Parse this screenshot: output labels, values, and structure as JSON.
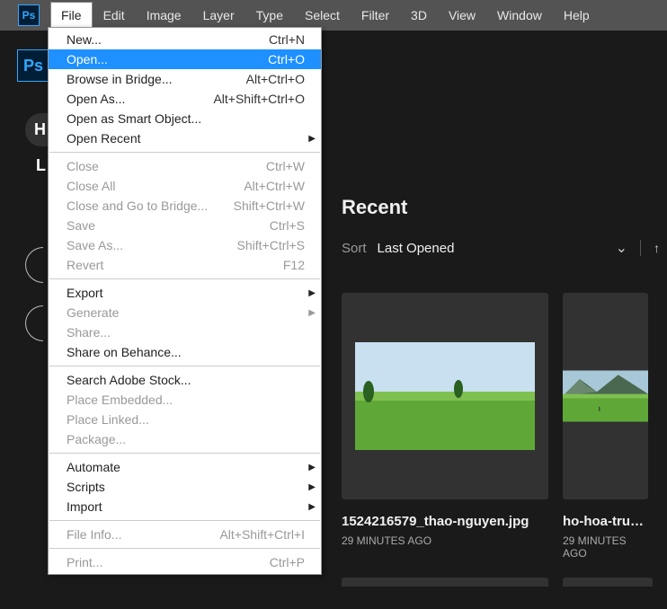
{
  "app_icon_text": "Ps",
  "menubar": [
    "File",
    "Edit",
    "Image",
    "Layer",
    "Type",
    "Select",
    "Filter",
    "3D",
    "View",
    "Window",
    "Help"
  ],
  "file_menu": [
    {
      "label": "New...",
      "shortcut": "Ctrl+N",
      "type": "item"
    },
    {
      "label": "Open...",
      "shortcut": "Ctrl+O",
      "type": "item",
      "highlight": true
    },
    {
      "label": "Browse in Bridge...",
      "shortcut": "Alt+Ctrl+O",
      "type": "item"
    },
    {
      "label": "Open As...",
      "shortcut": "Alt+Shift+Ctrl+O",
      "type": "item"
    },
    {
      "label": "Open as Smart Object...",
      "shortcut": "",
      "type": "item"
    },
    {
      "label": "Open Recent",
      "shortcut": "",
      "type": "submenu"
    },
    {
      "type": "sep"
    },
    {
      "label": "Close",
      "shortcut": "Ctrl+W",
      "type": "item",
      "disabled": true
    },
    {
      "label": "Close All",
      "shortcut": "Alt+Ctrl+W",
      "type": "item",
      "disabled": true
    },
    {
      "label": "Close and Go to Bridge...",
      "shortcut": "Shift+Ctrl+W",
      "type": "item",
      "disabled": true
    },
    {
      "label": "Save",
      "shortcut": "Ctrl+S",
      "type": "item",
      "disabled": true
    },
    {
      "label": "Save As...",
      "shortcut": "Shift+Ctrl+S",
      "type": "item",
      "disabled": true
    },
    {
      "label": "Revert",
      "shortcut": "F12",
      "type": "item",
      "disabled": true
    },
    {
      "type": "sep"
    },
    {
      "label": "Export",
      "shortcut": "",
      "type": "submenu"
    },
    {
      "label": "Generate",
      "shortcut": "",
      "type": "submenu",
      "disabled": true
    },
    {
      "label": "Share...",
      "shortcut": "",
      "type": "item",
      "disabled": true
    },
    {
      "label": "Share on Behance...",
      "shortcut": "",
      "type": "item"
    },
    {
      "type": "sep"
    },
    {
      "label": "Search Adobe Stock...",
      "shortcut": "",
      "type": "item"
    },
    {
      "label": "Place Embedded...",
      "shortcut": "",
      "type": "item",
      "disabled": true
    },
    {
      "label": "Place Linked...",
      "shortcut": "",
      "type": "item",
      "disabled": true
    },
    {
      "label": "Package...",
      "shortcut": "",
      "type": "item",
      "disabled": true
    },
    {
      "type": "sep"
    },
    {
      "label": "Automate",
      "shortcut": "",
      "type": "submenu"
    },
    {
      "label": "Scripts",
      "shortcut": "",
      "type": "submenu"
    },
    {
      "label": "Import",
      "shortcut": "",
      "type": "submenu"
    },
    {
      "type": "sep"
    },
    {
      "label": "File Info...",
      "shortcut": "Alt+Shift+Ctrl+I",
      "type": "item",
      "disabled": true
    },
    {
      "type": "sep"
    },
    {
      "label": "Print...",
      "shortcut": "Ctrl+P",
      "type": "item",
      "disabled": true
    }
  ],
  "side_letters": [
    "H",
    "L"
  ],
  "recent": {
    "title": "Recent",
    "sort_label": "Sort",
    "sort_value": "Last Opened",
    "items": [
      {
        "name": "1524216579_thao-nguyen.jpg",
        "time": "29 minutes ago"
      },
      {
        "name": "ho-hoa-trung-d",
        "time": "29 minutes ago"
      }
    ]
  }
}
